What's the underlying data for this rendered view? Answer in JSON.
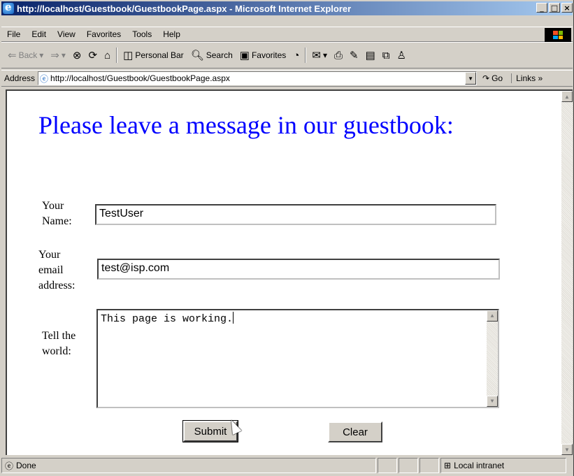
{
  "window": {
    "title": "http://localhost/Guestbook/GuestbookPage.aspx - Microsoft Internet Explorer",
    "minimize": "_",
    "maximize": "□",
    "close": "×"
  },
  "menu": [
    "File",
    "Edit",
    "View",
    "Favorites",
    "Tools",
    "Help"
  ],
  "toolbar": {
    "back": "Back",
    "personal_bar": "Personal Bar",
    "search": "Search",
    "favorites": "Favorites"
  },
  "address": {
    "label": "Address",
    "url": "http://localhost/Guestbook/GuestbookPage.aspx",
    "go": "Go",
    "links": "Links",
    "links_more": "»"
  },
  "page": {
    "heading": "Please leave a message in our guestbook:",
    "name_label": [
      "Your",
      "Name:"
    ],
    "name_value": "TestUser",
    "email_label": [
      "Your",
      "email",
      "address:"
    ],
    "email_value": "test@isp.com",
    "message_label": [
      "Tell the",
      "world:"
    ],
    "message_value": "This page is working.",
    "submit_label": "Submit",
    "clear_label": "Clear"
  },
  "status": {
    "text": "Done",
    "zone": "Local intranet"
  }
}
